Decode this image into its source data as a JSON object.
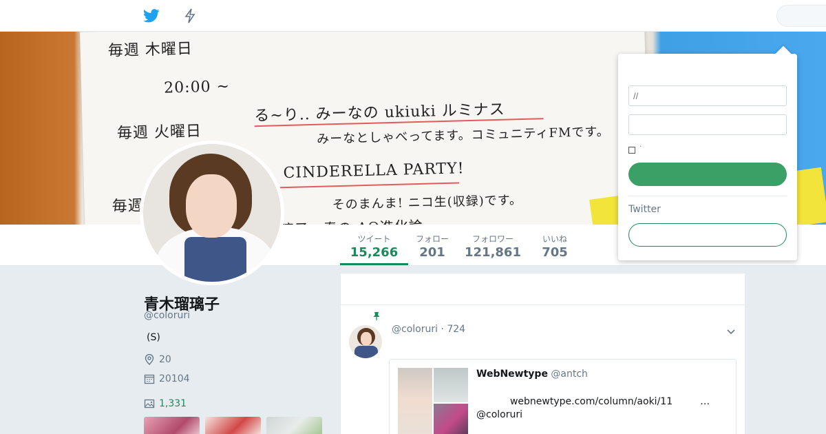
{
  "nav": {
    "bird_icon": "twitter-bird-icon",
    "bolt_icon": "moments-bolt-icon"
  },
  "stats": [
    {
      "label": "ツイート",
      "value": "15,266"
    },
    {
      "label": "フォロー",
      "value": "201"
    },
    {
      "label": "フォロワー",
      "value": "121,861"
    },
    {
      "label": "いいね",
      "value": "705"
    }
  ],
  "profile": {
    "name": "青木瑠璃子",
    "handle": "@coloruri",
    "bio": "(S)",
    "location": "20",
    "joined": "20104",
    "media_count": "1,331"
  },
  "tweet": {
    "meta": "@coloruri · 724",
    "card_title": "WebNewtype",
    "card_handle": "@antch",
    "card_line1": "           webnewtype.com/column/aoki/11         …",
    "card_line2": "@coloruri"
  },
  "login": {
    "username_placeholder": "//",
    "password_placeholder": "",
    "remember_label": "·",
    "signup_label": "Twitter"
  },
  "colors": {
    "accent": "#1b8a5a",
    "button": "#3aa066"
  }
}
